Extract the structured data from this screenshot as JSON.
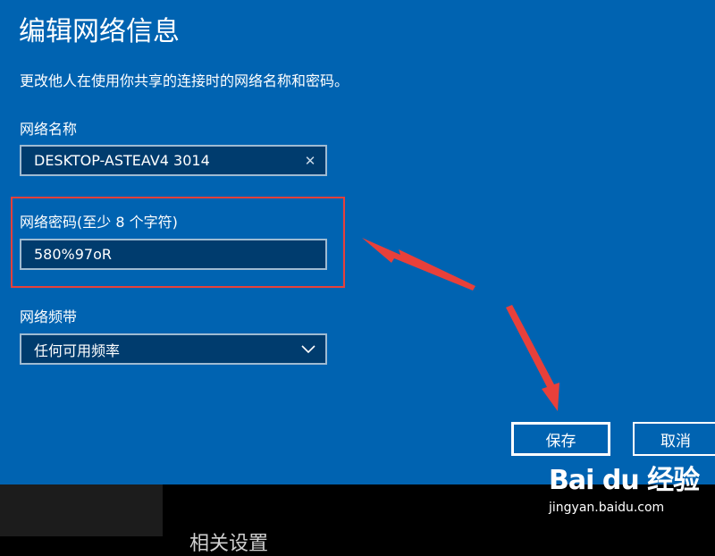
{
  "dialog": {
    "title": "编辑网络信息",
    "subtitle": "更改他人在使用你共享的连接时的网络名称和密码。"
  },
  "network_name": {
    "label": "网络名称",
    "value": "DESKTOP-ASTEAV4 3014",
    "clear_glyph": "✕"
  },
  "network_password": {
    "label": "网络密码(至少 8 个字符)",
    "value": "580%97oR"
  },
  "network_band": {
    "label": "网络频带",
    "selected": "任何可用频率"
  },
  "buttons": {
    "save": "保存",
    "cancel": "取消"
  },
  "background": {
    "related_settings": "相关设置"
  },
  "watermark": {
    "brand": "Bai du 经验",
    "url": "jingyan.baidu.com"
  },
  "colors": {
    "dialog_bg": "#0063b1",
    "field_bg": "#003c6e",
    "field_border": "#9fbbd2",
    "annotation_red": "#e8403a"
  },
  "icons": {
    "clear": "clear-icon",
    "dropdown": "chevron-down-icon"
  }
}
